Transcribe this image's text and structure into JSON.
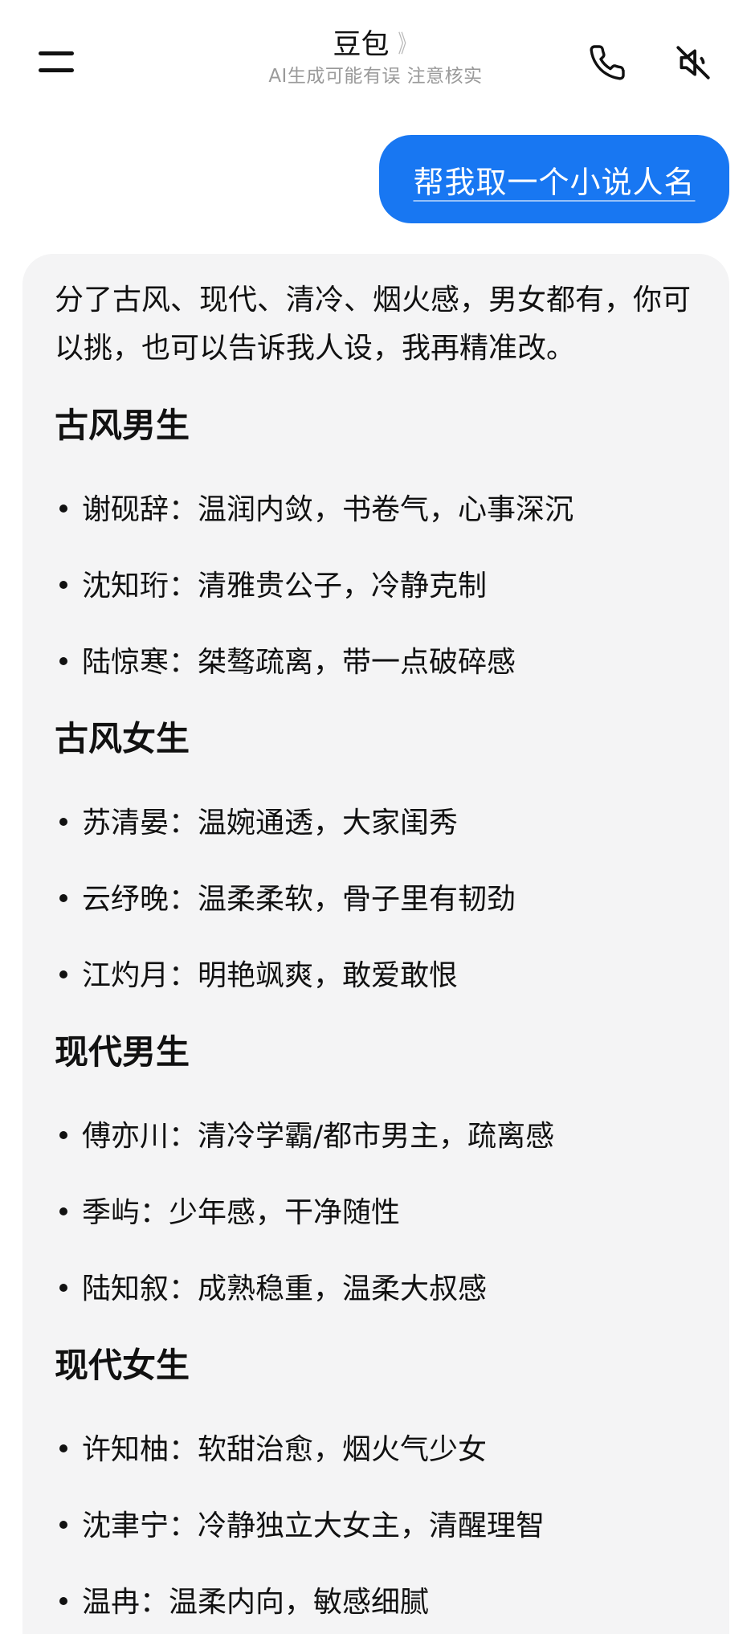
{
  "header": {
    "title": "豆包",
    "title_chevron": "》",
    "subtitle": "AI生成可能有误 注意核实",
    "menu_icon": "hamburger-menu-icon",
    "call_icon": "phone-icon",
    "mute_icon": "speaker-muted-icon"
  },
  "user_message": {
    "text": "帮我取一个小说人名",
    "bubble_color": "#1877f2"
  },
  "answer": {
    "intro": "分了古风、现代、清冷、烟火感，男女都有，你可以挑，也可以告诉我人设，我再精准改。",
    "sections": [
      {
        "title": "古风男生",
        "items": [
          "谢砚辞：温润内敛，书卷气，心事深沉",
          "沈知珩：清雅贵公子，冷静克制",
          "陆惊寒：桀骜疏离，带一点破碎感"
        ]
      },
      {
        "title": "古风女生",
        "items": [
          "苏清晏：温婉通透，大家闺秀",
          "云纾晚：温柔柔软，骨子里有韧劲",
          "江灼月：明艳飒爽，敢爱敢恨"
        ]
      },
      {
        "title": "现代男生",
        "items": [
          "傅亦川：清冷学霸/都市男主，疏离感",
          "季屿：少年感，干净随性",
          "陆知叙：成熟稳重，温柔大叔感"
        ]
      },
      {
        "title": "现代女生",
        "items": [
          "许知柚：软甜治愈，烟火气少女",
          "沈聿宁：冷静独立大女主，清醒理智",
          "温冉：温柔内向，敏感细腻"
        ]
      }
    ]
  }
}
